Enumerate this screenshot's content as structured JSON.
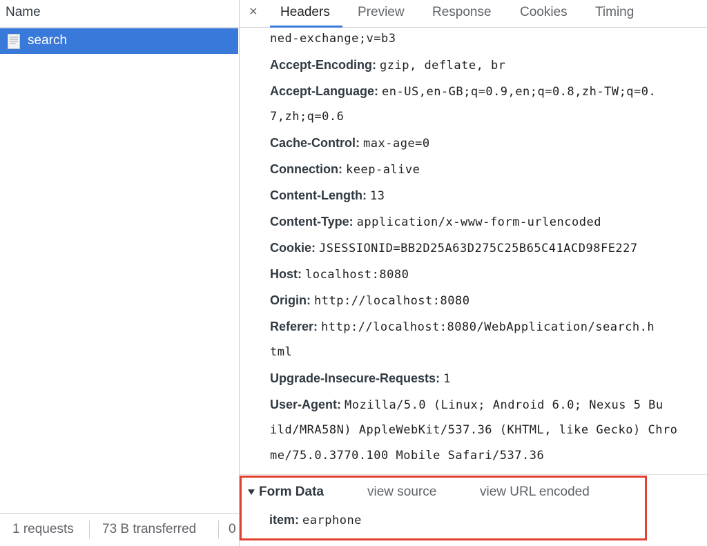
{
  "left": {
    "column_title": "Name",
    "requests": [
      {
        "name": "search"
      }
    ],
    "status": {
      "requests": "1 requests",
      "transferred": "73 B transferred",
      "extra": "0"
    }
  },
  "tabs": {
    "close_glyph": "×",
    "items": [
      "Headers",
      "Preview",
      "Response",
      "Cookies",
      "Timing"
    ],
    "active": "Headers"
  },
  "headers": {
    "top_continuation": "ned-exchange;v=b3",
    "items": [
      {
        "key": "Accept-Encoding:",
        "value": "gzip, deflate, br"
      },
      {
        "key": "Accept-Language:",
        "value": "en-US,en-GB;q=0.9,en;q=0.8,zh-TW;q=0.",
        "continuation": [
          "7,zh;q=0.6"
        ]
      },
      {
        "key": "Cache-Control:",
        "value": "max-age=0"
      },
      {
        "key": "Connection:",
        "value": "keep-alive"
      },
      {
        "key": "Content-Length:",
        "value": "13"
      },
      {
        "key": "Content-Type:",
        "value": "application/x-www-form-urlencoded"
      },
      {
        "key": "Cookie:",
        "value": "JSESSIONID=BB2D25A63D275C25B65C41ACD98FE227"
      },
      {
        "key": "Host:",
        "value": "localhost:8080"
      },
      {
        "key": "Origin:",
        "value": "http://localhost:8080"
      },
      {
        "key": "Referer:",
        "value": "http://localhost:8080/WebApplication/search.h",
        "continuation": [
          "tml"
        ]
      },
      {
        "key": "Upgrade-Insecure-Requests:",
        "value": "1"
      },
      {
        "key": "User-Agent:",
        "value": "Mozilla/5.0 (Linux; Android 6.0; Nexus 5 Bu",
        "continuation": [
          "ild/MRA58N) AppleWebKit/537.36 (KHTML, like Gecko) Chro",
          "me/75.0.3770.100 Mobile Safari/537.36"
        ]
      }
    ]
  },
  "form_data": {
    "title": "Form Data",
    "view_source": "view source",
    "view_url_encoded": "view URL encoded",
    "items": [
      {
        "key": "item:",
        "value": "earphone"
      }
    ]
  },
  "colors": {
    "selection": "#3879d9",
    "highlight_border": "#e1412f"
  }
}
